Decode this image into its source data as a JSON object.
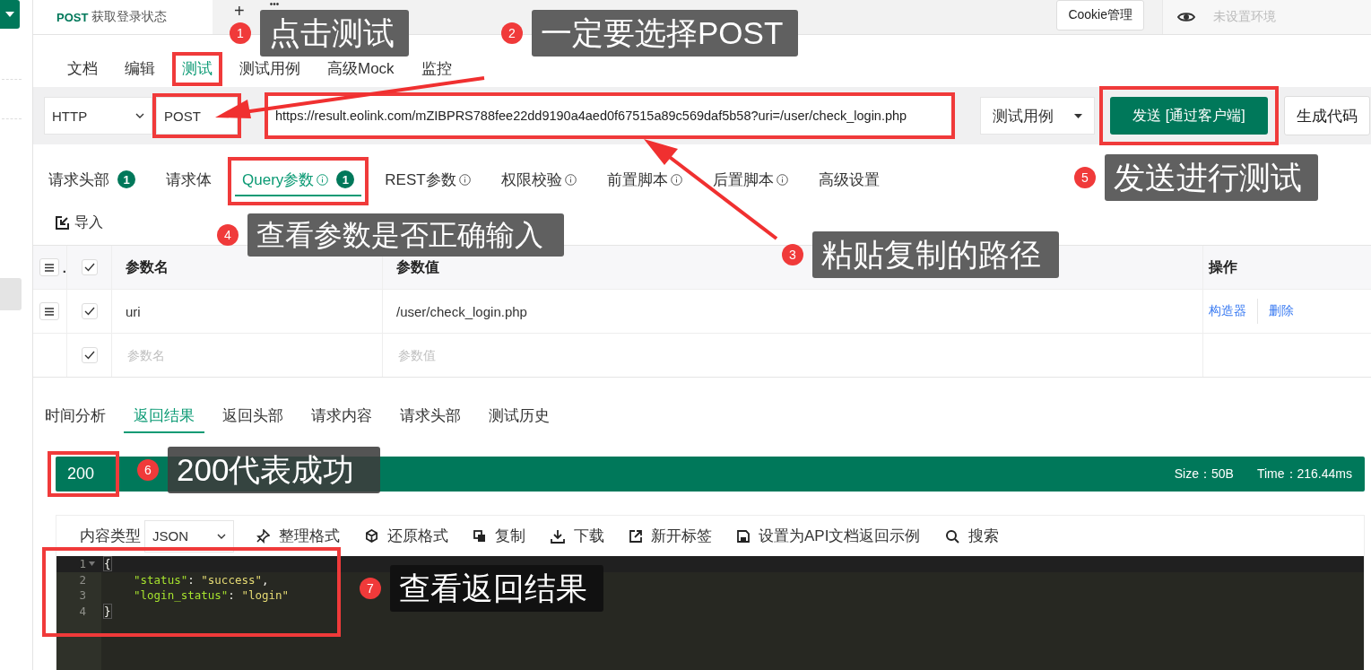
{
  "doc_tabs": [
    {
      "method": "POST",
      "title": "获取登录状态",
      "selected": true
    }
  ],
  "add_tab": "+",
  "more_tabs": "•••",
  "cookie_button": "Cookie管理",
  "environment": {
    "placeholder": "未设置环境"
  },
  "nav_tabs": [
    {
      "label": "文档",
      "selected": false,
      "highlighted": false
    },
    {
      "label": "编辑",
      "selected": false,
      "highlighted": false
    },
    {
      "label": "测试",
      "selected": true,
      "highlighted": true
    },
    {
      "label": "测试用例",
      "selected": false,
      "highlighted": false
    },
    {
      "label": "高级Mock",
      "selected": false,
      "highlighted": false
    },
    {
      "label": "监控",
      "selected": false,
      "highlighted": false
    }
  ],
  "request": {
    "protocol": "HTTP",
    "method": "POST",
    "method_highlighted": true,
    "url": "https://result.eolink.com/mZIBPRS788fee22dd9190a4aed0f67515a89c569daf5b58?uri=/user/check_login.php",
    "url_highlighted": true,
    "case_select": "测试用例",
    "send_button": "发送 [通过客户端]",
    "send_highlighted": true,
    "code_button": "生成代码"
  },
  "param_tabs": [
    {
      "label": "请求头部",
      "info": false,
      "badge": "1",
      "selected": false,
      "highlighted": false
    },
    {
      "label": "请求体",
      "info": false,
      "selected": false,
      "highlighted": false
    },
    {
      "label": "Query参数",
      "info": true,
      "badge": "1",
      "selected": true,
      "highlighted": true
    },
    {
      "label": "REST参数",
      "info": true,
      "selected": false,
      "highlighted": false
    },
    {
      "label": "权限校验",
      "info": true,
      "selected": false,
      "highlighted": false
    },
    {
      "label": "前置脚本",
      "info": true,
      "selected": false,
      "highlighted": false
    },
    {
      "label": "后置脚本",
      "info": true,
      "selected": false,
      "highlighted": false
    },
    {
      "label": "高级设置",
      "info": false,
      "selected": false,
      "highlighted": false
    }
  ],
  "import_button": "导入",
  "table": {
    "column_1": ".",
    "all_checked": true,
    "columns": [
      "参数名",
      "参数值",
      "操作"
    ],
    "rows": [
      {
        "checked": true,
        "name": "uri",
        "value": "/user/check_login.php",
        "actions": [
          "构造器",
          "删除"
        ]
      }
    ],
    "new_row": {
      "checked": true,
      "name_placeholder": "参数名",
      "value_placeholder": "参数值"
    }
  },
  "result_tabs": [
    {
      "label": "时间分析",
      "selected": false
    },
    {
      "label": "返回结果",
      "selected": true
    },
    {
      "label": "返回头部",
      "selected": false
    },
    {
      "label": "请求内容",
      "selected": false
    },
    {
      "label": "请求头部",
      "selected": false
    },
    {
      "label": "测试历史",
      "selected": false
    }
  ],
  "status": {
    "code": "200",
    "code_highlighted": true,
    "size": "Size：50B",
    "time": "Time：216.44ms"
  },
  "toolbar": {
    "content_type_label": "内容类型",
    "content_type": "JSON",
    "actions": [
      {
        "kind": "format",
        "label": "整理格式"
      },
      {
        "kind": "raw",
        "label": "还原格式"
      },
      {
        "kind": "copy",
        "label": "复制"
      },
      {
        "kind": "download",
        "label": "下载"
      },
      {
        "kind": "open",
        "label": "新开标签"
      },
      {
        "kind": "save",
        "label": "设置为API文档返回示例"
      },
      {
        "kind": "search",
        "label": "搜索"
      }
    ]
  },
  "code_highlighted": true,
  "code_lines": [
    {
      "number": "1",
      "fold": true,
      "tokens": [
        {
          "kind": "brace",
          "text": "{"
        }
      ]
    },
    {
      "number": "2",
      "fold": false,
      "tokens": [
        {
          "kind": "key",
          "text": "\"status\""
        },
        {
          "kind": "punct",
          "text": ": "
        },
        {
          "kind": "string",
          "text": "\"success\""
        },
        {
          "kind": "punct",
          "text": ","
        }
      ]
    },
    {
      "number": "3",
      "fold": false,
      "tokens": [
        {
          "kind": "key",
          "text": "\"login_status\""
        },
        {
          "kind": "punct",
          "text": ": "
        },
        {
          "kind": "string",
          "text": "\"login\""
        }
      ]
    },
    {
      "number": "4",
      "fold": false,
      "tokens": [
        {
          "kind": "brace",
          "text": "}"
        }
      ]
    }
  ],
  "annotations": [
    {
      "number": "1",
      "text": "点击测试"
    },
    {
      "number": "2",
      "text": "一定要选择POST"
    },
    {
      "number": "3",
      "text": "粘贴复制的路径"
    },
    {
      "number": "4",
      "text": "查看参数是否正确输入"
    },
    {
      "number": "5",
      "text": "发送进行测试"
    },
    {
      "number": "6",
      "text": "200代表成功"
    },
    {
      "number": "7",
      "text": "查看返回结果"
    }
  ]
}
